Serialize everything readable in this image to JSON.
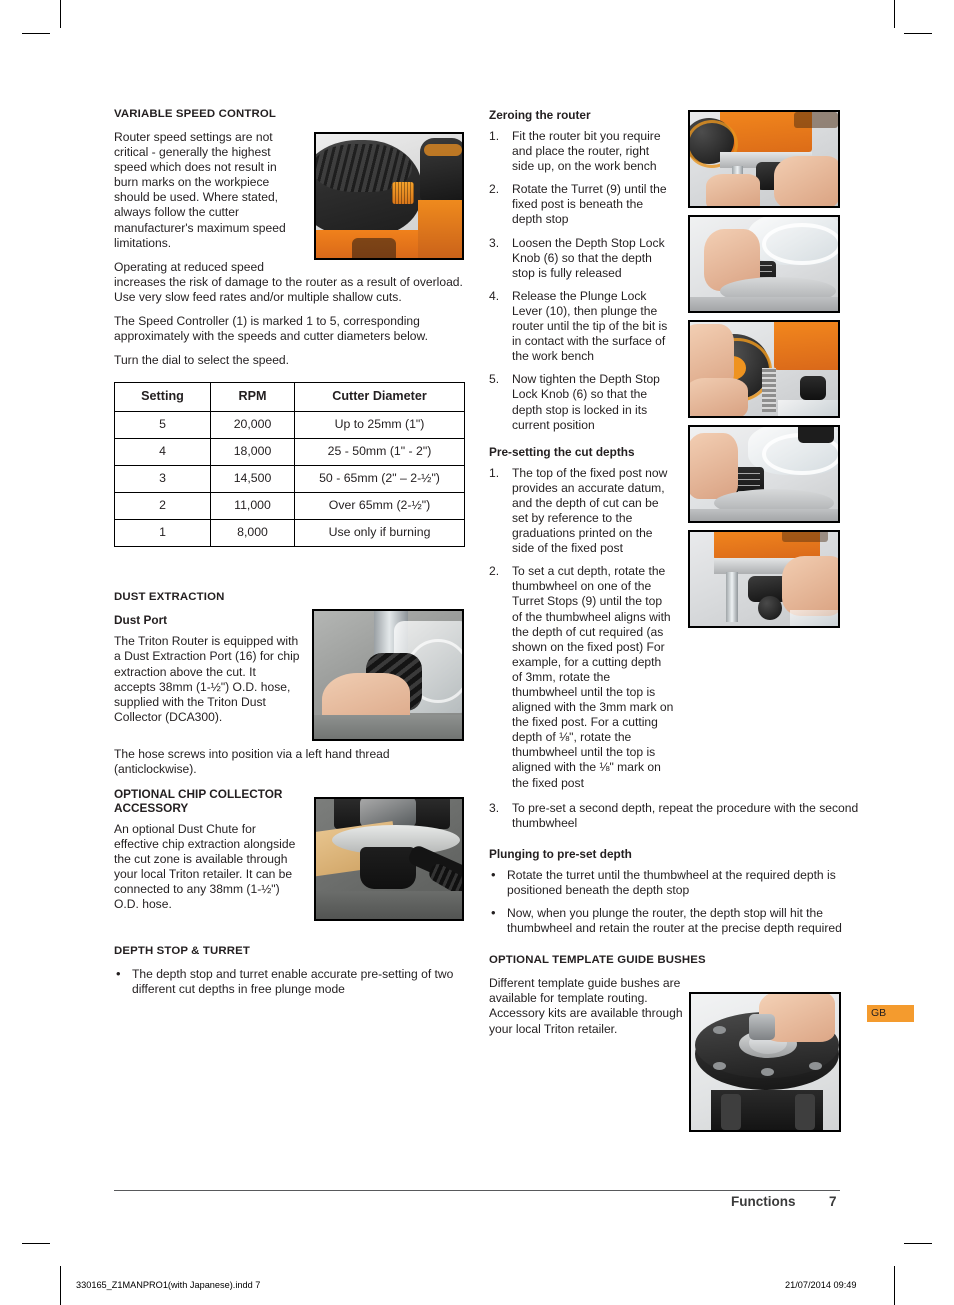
{
  "document": {
    "footer_section": "Functions",
    "page_number": "7",
    "imprint_left": "330165_Z1MANPRO1(with Japanese).indd   7",
    "imprint_right": "21/07/2014   09:49",
    "locale_tab": "GB",
    "accent_color": "#f49b2e"
  },
  "left_column": {
    "variable_speed": {
      "heading": "VARIABLE SPEED CONTROL",
      "paragraphs": [
        "Router speed settings are not critical - generally the highest speed which does not result in burn marks on the workpiece should be used. Where stated, always follow the cutter manufacturer's maximum speed limitations.",
        "Operating at reduced speed increases the risk of damage to the router as a result of overload. Use very slow feed rates and/or multiple shallow cuts.",
        "The Speed Controller (1) is marked 1 to 5, corresponding approximately with the speeds and cutter diameters below.",
        "Turn the dial to select the speed."
      ],
      "image_caption": "router-speed-dial-photo"
    },
    "speed_table": {
      "headers": [
        "Setting",
        "RPM",
        "Cutter Diameter"
      ],
      "rows": [
        [
          "5",
          "20,000",
          "Up to 25mm (1\")"
        ],
        [
          "4",
          "18,000",
          "25 - 50mm (1\" - 2\")"
        ],
        [
          "3",
          "14,500",
          "50 - 65mm (2\" – 2-½\")"
        ],
        [
          "2",
          "11,000",
          "Over 65mm (2-½\")"
        ],
        [
          "1",
          "8,000",
          "Use only if burning"
        ]
      ]
    },
    "dust_extraction": {
      "heading": "DUST EXTRACTION",
      "dust_port": {
        "subheading": "Dust Port",
        "paragraphs": [
          "The Triton Router is equipped with a Dust Extraction Port (16) for chip extraction above the cut. It accepts 38mm (1-½\") O.D. hose, supplied with the Triton Dust Collector (DCA300).",
          "The hose screws into position via a left hand thread (anticlockwise)."
        ],
        "image_caption": "dust-extraction-port-photo"
      },
      "chip_collector": {
        "subheading": "OPTIONAL CHIP COLLECTOR ACCESSORY",
        "paragraphs": [
          "An optional Dust Chute for effective chip extraction alongside the cut zone is available through your local Triton retailer. It can be connected to any 38mm (1-½\") O.D. hose."
        ],
        "image_caption": "chip-collector-dust-chute-photo"
      }
    },
    "depth_stop_turret": {
      "heading": "DEPTH STOP & TURRET",
      "bullets": [
        "The depth stop and turret enable accurate pre-setting of two different cut depths in free plunge mode"
      ]
    }
  },
  "right_column": {
    "zeroing": {
      "heading": "Zeroing the router",
      "steps": [
        "Fit the router bit you require and place the router, right side up, on the work bench",
        "Rotate the Turret (9) until the fixed post is beneath the depth stop",
        "Loosen the Depth Stop Lock Knob (6) so that the depth stop is fully released",
        "Release the Plunge Lock Lever (10), then plunge the router until the tip of the bit is in contact with the surface of the work bench",
        "Now tighten the Depth Stop Lock Knob (6) so that the depth stop is locked in its current position"
      ]
    },
    "pre_setting": {
      "heading": "Pre-setting the cut depths",
      "steps": [
        "The top of the fixed post now provides an accurate datum, and the depth of cut can be set by reference to the graduations printed on the side of the fixed post",
        "To set a cut depth, rotate the thumbwheel on one of the Turret Stops (9) until the top of the thumbwheel aligns with the depth of cut required (as shown on the fixed post) For example, for a cutting depth of 3mm, rotate the thumbwheel until the top is aligned with the 3mm mark on the fixed post. For a cutting depth of ⅛\", rotate the thumbwheel until the top is aligned with the ⅛\" mark on the fixed post",
        "To pre-set a second depth, repeat the procedure with the second thumbwheel"
      ]
    },
    "plunging": {
      "heading": "Plunging to pre-set depth",
      "bullets": [
        "Rotate the turret until the thumbwheel at the required depth is positioned beneath the depth stop",
        "Now, when you plunge the router, the depth stop will hit the thumbwheel and retain the router at the precise depth required"
      ]
    },
    "template_bushes": {
      "heading": "OPTIONAL TEMPLATE GUIDE BUSHES",
      "paragraphs": [
        "Different template guide bushes are available for template routing. Accessory kits are available through your local Triton retailer."
      ],
      "image_caption": "template-guide-bush-photo"
    },
    "photo_strip": [
      "zeroing-step-1-photo",
      "zeroing-step-2-photo",
      "zeroing-step-3-photo",
      "zeroing-step-4-photo",
      "zeroing-step-5-photo"
    ]
  }
}
